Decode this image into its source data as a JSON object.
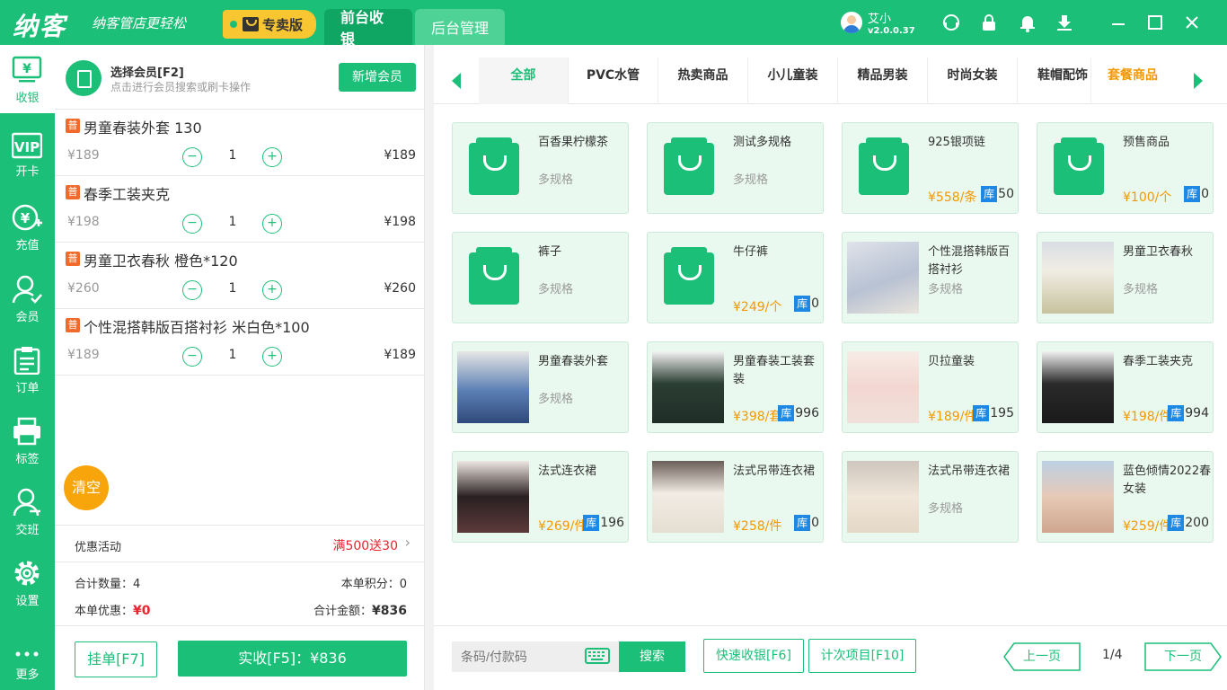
{
  "app": {
    "logo": "纳客",
    "slogan": "纳客管店更轻松",
    "edition": "专卖版",
    "nav": [
      "前台收银",
      "后台管理"
    ],
    "user": {
      "name": "艾小",
      "version": "v2.0.0.37"
    }
  },
  "sidebar": {
    "items": [
      {
        "label": "收银",
        "icon": "cashier-icon"
      },
      {
        "label": "开卡",
        "icon": "vip-icon"
      },
      {
        "label": "充值",
        "icon": "recharge-icon"
      },
      {
        "label": "会员",
        "icon": "member-icon"
      },
      {
        "label": "订单",
        "icon": "order-icon"
      },
      {
        "label": "标签",
        "icon": "printer-icon"
      },
      {
        "label": "交班",
        "icon": "shift-icon"
      },
      {
        "label": "设置",
        "icon": "gear-icon"
      },
      {
        "label": "更多",
        "icon": "more-icon"
      }
    ]
  },
  "member": {
    "title": "选择会员[F2]",
    "hint": "点击进行会员搜索或刷卡操作",
    "add_label": "新增会员"
  },
  "cart": {
    "tag": "普",
    "items": [
      {
        "name": "男童春装外套 130",
        "price": "¥189",
        "qty": "1",
        "total": "¥189"
      },
      {
        "name": "春季工装夹克",
        "price": "¥198",
        "qty": "1",
        "total": "¥198"
      },
      {
        "name": "男童卫衣春秋 橙色*120",
        "price": "¥260",
        "qty": "1",
        "total": "¥260"
      },
      {
        "name": "个性混搭韩版百搭衬衫 米白色*100",
        "price": "¥189",
        "qty": "1",
        "total": "¥189"
      }
    ],
    "clear_label": "清空"
  },
  "promo": {
    "label": "优惠活动",
    "value": "满500送30"
  },
  "summary": {
    "qty_label": "合计数量：4",
    "points_label": "本单积分：0",
    "discount_label": "本单优惠：",
    "discount_value": "¥0",
    "amount_label": "合计金额：",
    "amount_value": "¥836"
  },
  "actions": {
    "hang": "挂单[F7]",
    "pay": "实收[F5]：¥836"
  },
  "categories": [
    "全部",
    "PVC水管",
    "热卖商品",
    "小儿童装",
    "精品男装",
    "时尚女装",
    "鞋帽配饰",
    "套餐商品"
  ],
  "products": [
    {
      "title": "百香果柠檬茶",
      "spec": "多规格",
      "price": "",
      "stock": "",
      "img": "bag"
    },
    {
      "title": "测试多规格",
      "spec": "多规格",
      "price": "",
      "stock": "",
      "img": "bag"
    },
    {
      "title": "925银项链",
      "spec": "",
      "price": "¥558/条",
      "stock": "50",
      "img": "bag"
    },
    {
      "title": "预售商品",
      "spec": "",
      "price": "¥100/个",
      "stock": "0",
      "img": "bag"
    },
    {
      "title": "裤子",
      "spec": "多规格",
      "price": "",
      "stock": "",
      "img": "bag"
    },
    {
      "title": "牛仔裤",
      "spec": "",
      "price": "¥249/个",
      "stock": "0",
      "img": "bag"
    },
    {
      "title": "个性混搭韩版百搭衬衫",
      "spec": "多规格",
      "price": "",
      "stock": "",
      "img": "photo-shirt"
    },
    {
      "title": "男童卫衣春秋",
      "spec": "多规格",
      "price": "",
      "stock": "",
      "img": "photo-boy"
    },
    {
      "title": "男童春装外套",
      "spec": "多规格",
      "price": "",
      "stock": "",
      "img": "photo-twins"
    },
    {
      "title": "男童春装工装套装",
      "spec": "",
      "price": "¥398/套",
      "stock": "996",
      "img": "photo-suit"
    },
    {
      "title": "贝拉童装",
      "spec": "",
      "price": "¥189/件",
      "stock": "195",
      "img": "photo-girl"
    },
    {
      "title": "春季工装夹克",
      "spec": "",
      "price": "¥198/件",
      "stock": "994",
      "img": "photo-jacket"
    },
    {
      "title": "法式连衣裙",
      "spec": "",
      "price": "¥269/件",
      "stock": "196",
      "img": "photo-dress-black"
    },
    {
      "title": "法式吊带连衣裙",
      "spec": "",
      "price": "¥258/件",
      "stock": "0",
      "img": "photo-dress-white"
    },
    {
      "title": "法式吊带连衣裙",
      "spec": "多规格",
      "price": "",
      "stock": "",
      "img": "photo-dress-cream"
    },
    {
      "title": "蓝色倾情2022春女装",
      "spec": "",
      "price": "¥259/件",
      "stock": "200",
      "img": "photo-dress-pink"
    }
  ],
  "stock_tag": "库",
  "bottom": {
    "barcode_placeholder": "条码/付款码",
    "search": "搜索",
    "quick": "快速收银[F6]",
    "count": "计次项目[F10]",
    "prev": "上一页",
    "page": "1/4",
    "next": "下一页"
  },
  "colors": {
    "primary": "#1cbf78",
    "accent": "#f39800",
    "danger": "#e6262e",
    "stock": "#1e88e5"
  }
}
